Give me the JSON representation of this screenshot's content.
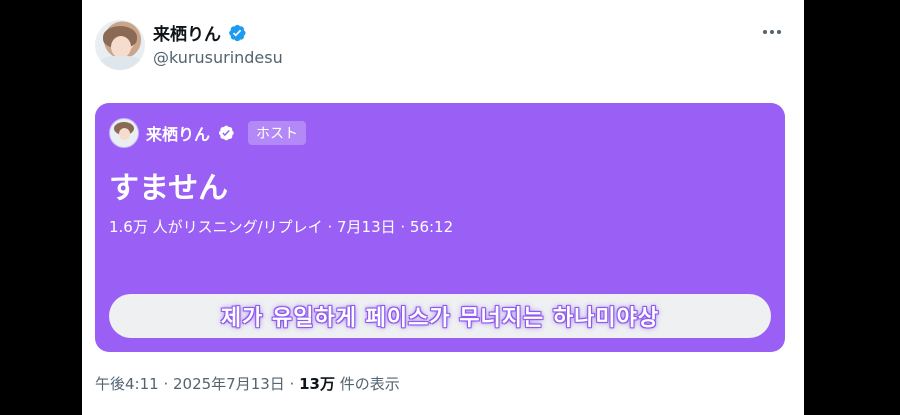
{
  "tweet": {
    "author_name": "来栖りん",
    "handle": "@kurusurindesu",
    "more_icon": "more-dots-icon",
    "verified_color": "#1d9bf0"
  },
  "space": {
    "host_name": "来栖りん",
    "host_badge": "ホスト",
    "title": "すません",
    "meta": "1.6万 人がリスニング/リプレイ · 7月13日 · 56:12",
    "button_label": "제가 유일하게 페이스가 무너지는 하나미야상",
    "card_color": "#9a5ff4"
  },
  "footer": {
    "time_date": "午後4:11 · 2025年7月13日 · ",
    "views_count": "13万",
    "views_suffix": " 件の表示"
  }
}
